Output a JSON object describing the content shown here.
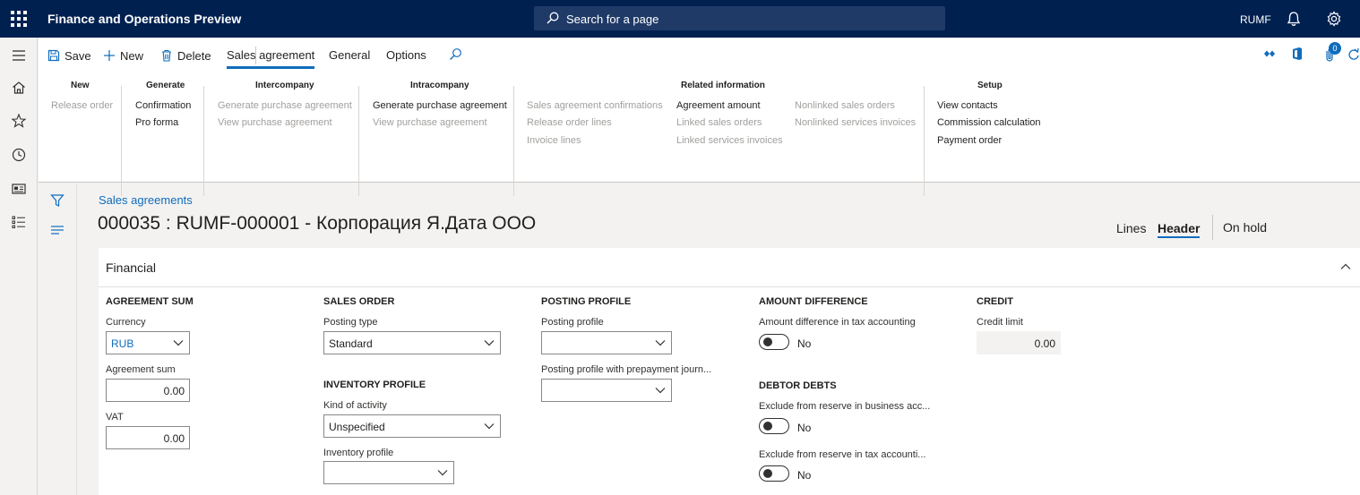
{
  "app": {
    "title": "Finance and Operations Preview",
    "search_placeholder": "Search for a page",
    "company": "RUMF"
  },
  "toolbar": {
    "save": "Save",
    "new": "New",
    "delete": "Delete",
    "tabs": [
      "Sales agreement",
      "General",
      "Options"
    ],
    "active_tab": "Sales agreement",
    "badge_count": "0"
  },
  "ribbon": {
    "new": {
      "title": "New",
      "items": [
        "Release order"
      ]
    },
    "generate": {
      "title": "Generate",
      "items": [
        "Confirmation",
        "Pro forma"
      ]
    },
    "intercompany": {
      "title": "Intercompany",
      "items": [
        "Generate purchase agreement",
        "View purchase agreement"
      ]
    },
    "intracompany": {
      "title": "Intracompany",
      "items": [
        "Generate purchase agreement",
        "View purchase agreement"
      ]
    },
    "related": {
      "title": "Related information",
      "col1": [
        "Sales agreement confirmations",
        "Release order lines",
        "Invoice lines"
      ],
      "col2": [
        "Agreement amount",
        "Linked sales orders",
        "Linked services invoices"
      ],
      "col3": [
        "Nonlinked sales orders",
        "Nonlinked services invoices"
      ]
    },
    "setup": {
      "title": "Setup",
      "items": [
        "View contacts",
        "Commission calculation",
        "Payment order"
      ]
    }
  },
  "page": {
    "breadcrumb": "Sales agreements",
    "title": "000035 : RUMF-000001 - Корпорация Я.Дата ООО",
    "views": [
      "Lines",
      "Header"
    ],
    "active_view": "Header",
    "on_hold": "On hold"
  },
  "financial": {
    "title": "Financial",
    "agreement_sum": {
      "title": "AGREEMENT SUM",
      "currency_label": "Currency",
      "currency_value": "RUB",
      "sum_label": "Agreement sum",
      "sum_value": "0.00",
      "vat_label": "VAT",
      "vat_value": "0.00"
    },
    "sales_order": {
      "title": "SALES ORDER",
      "posting_type_label": "Posting type",
      "posting_type_value": "Standard"
    },
    "inventory_profile": {
      "title": "INVENTORY PROFILE",
      "kind_label": "Kind of activity",
      "kind_value": "Unspecified",
      "profile_label": "Inventory profile",
      "profile_value": ""
    },
    "posting_profile": {
      "title": "POSTING PROFILE",
      "profile_label": "Posting profile",
      "profile_value": "",
      "prepay_label": "Posting profile with prepayment journ...",
      "prepay_value": ""
    },
    "amount_difference": {
      "title": "AMOUNT DIFFERENCE",
      "tax_label": "Amount difference in tax accounting",
      "tax_value": "No"
    },
    "debtor_debts": {
      "title": "DEBTOR DEBTS",
      "business_label": "Exclude from reserve in business acc...",
      "business_value": "No",
      "tax_label": "Exclude from reserve in tax accounti...",
      "tax_value": "No"
    },
    "credit": {
      "title": "CREDIT",
      "limit_label": "Credit limit",
      "limit_value": "0.00"
    }
  },
  "colors": {
    "navbar": "#002050",
    "accent": "#0f6cbd"
  }
}
